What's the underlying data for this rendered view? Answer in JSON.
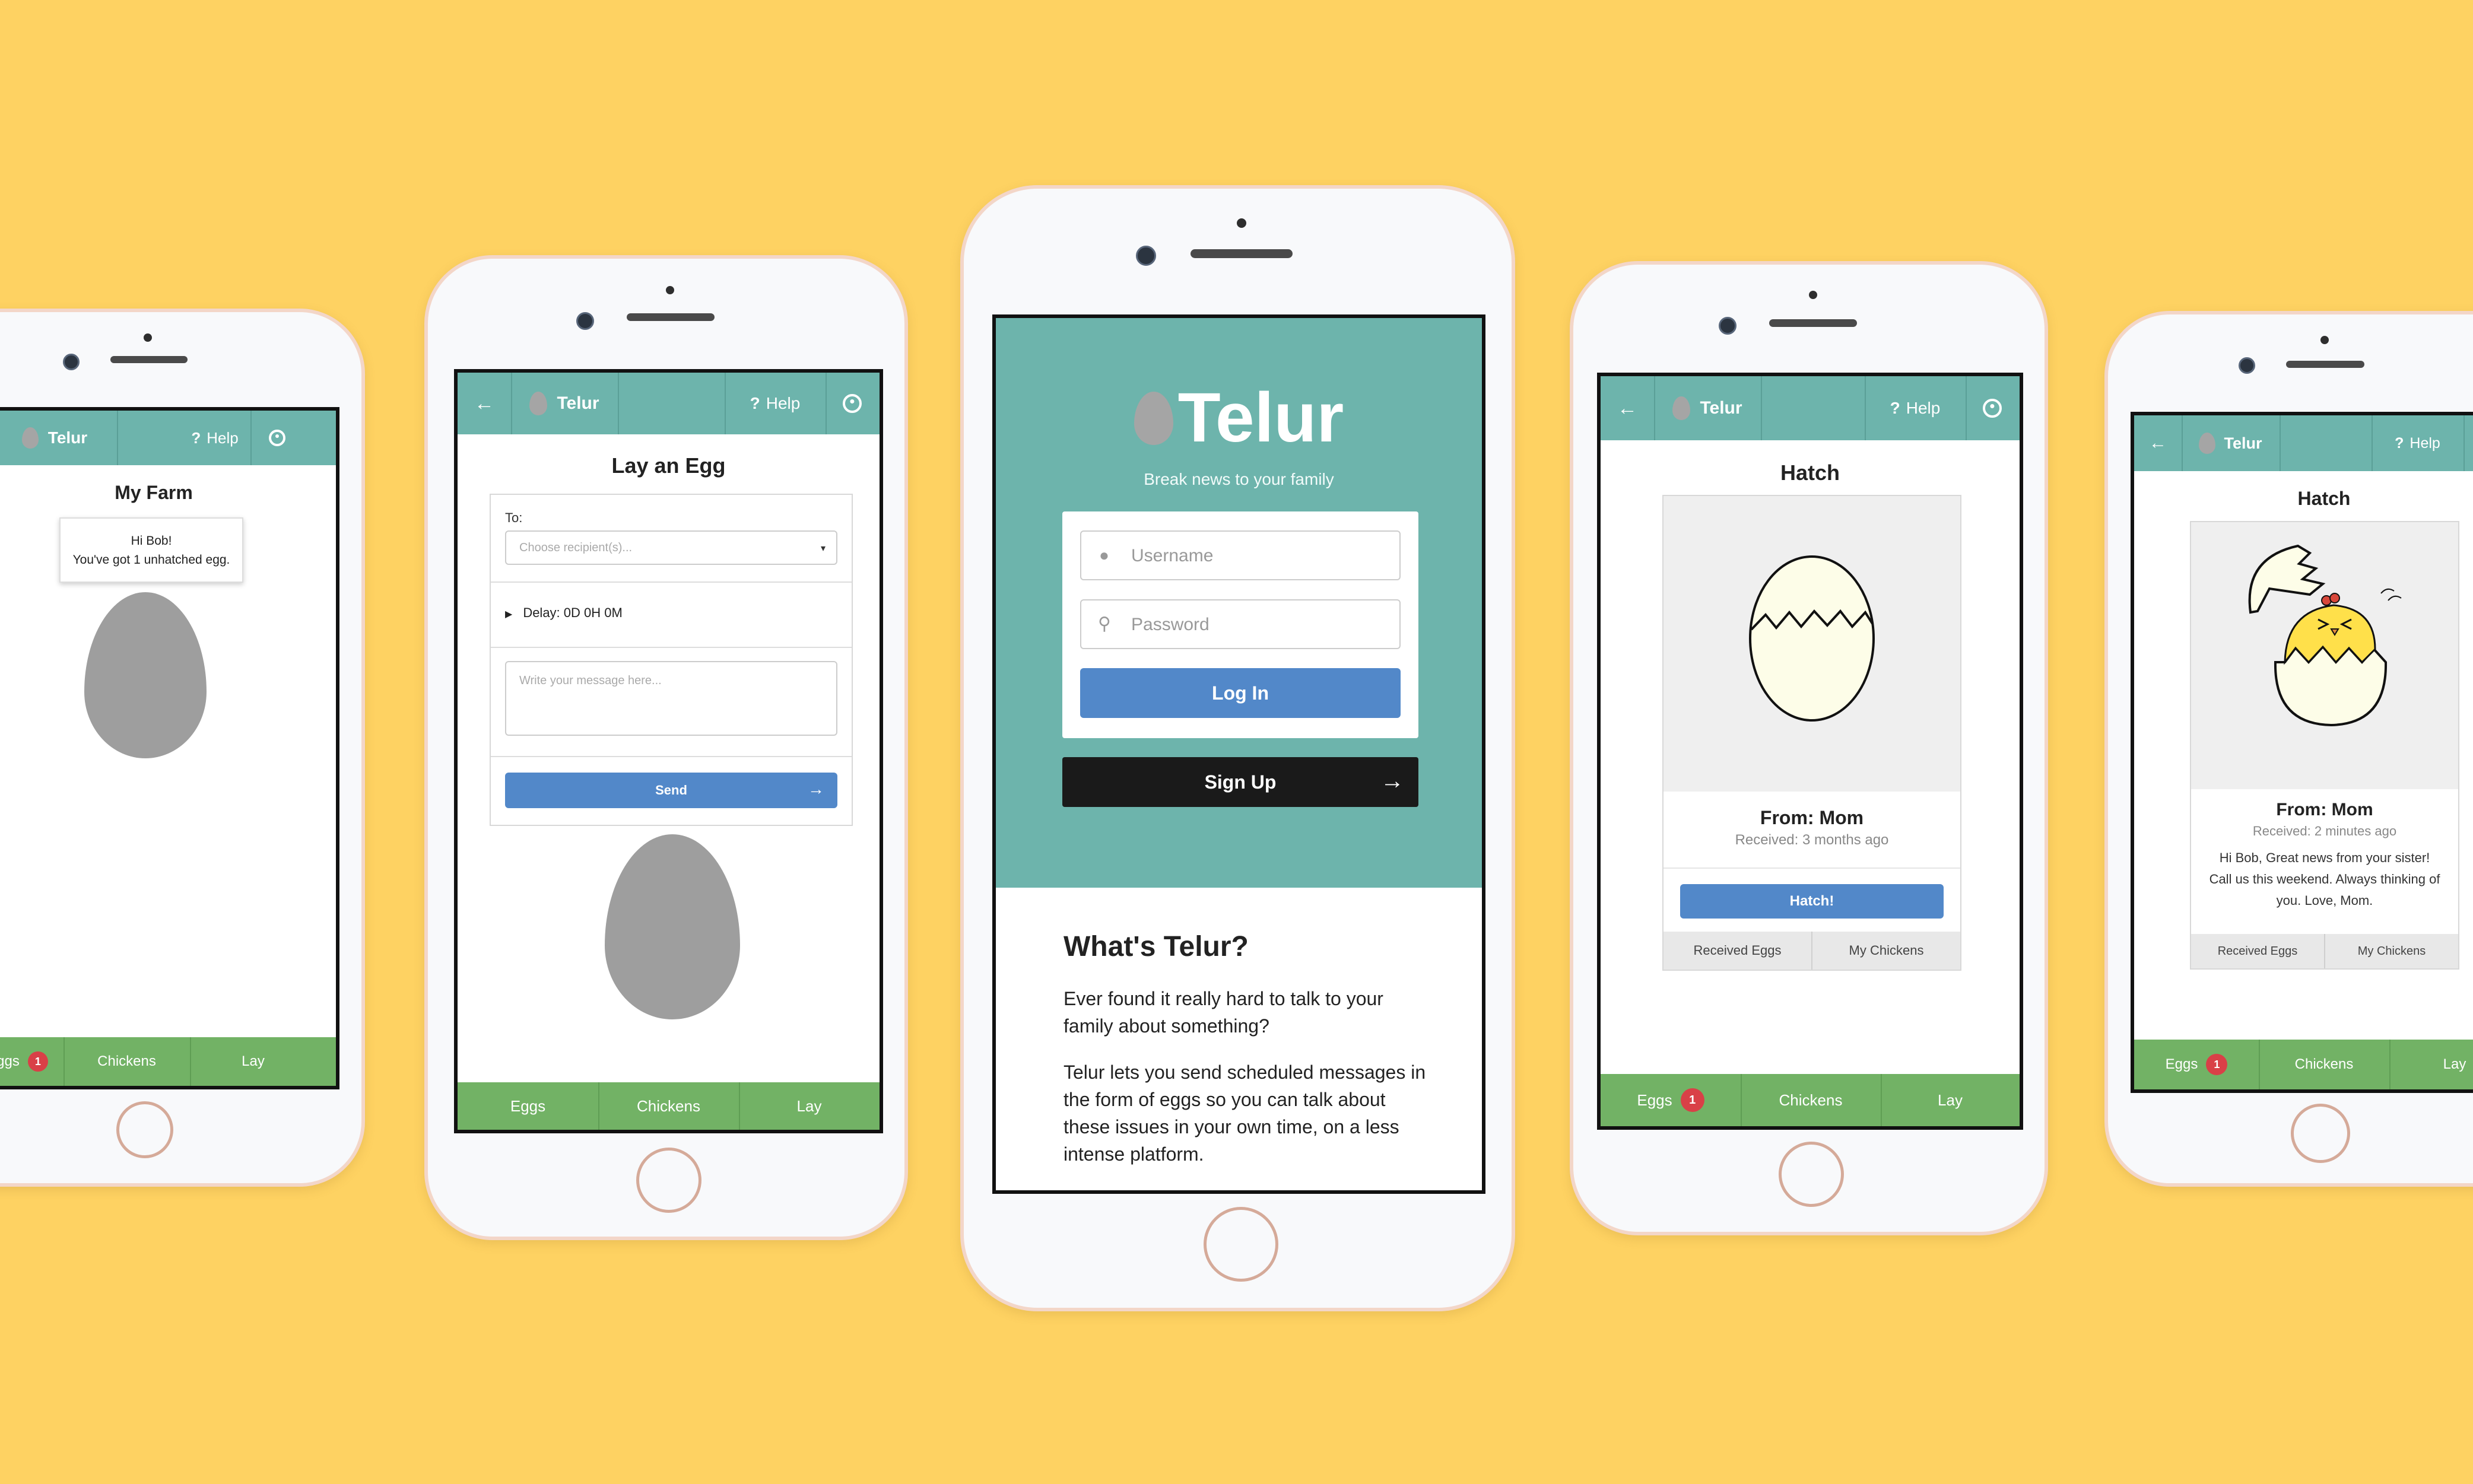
{
  "colors": {
    "background": "#FED262",
    "teal": "#6db4ac",
    "green": "#72b265",
    "blue": "#5288c9",
    "badge": "#d94047",
    "dark": "#1a1a1a"
  },
  "app": {
    "name": "Telur",
    "help_label": "Help",
    "help_icon": "question-icon",
    "back_icon": "arrow-left-icon",
    "user_icon": "user-circle-icon"
  },
  "nav": {
    "eggs": "Eggs",
    "chickens": "Chickens",
    "lay": "Lay",
    "badge_count": "1"
  },
  "phone1": {
    "title": "My Farm",
    "tooltip_line1": "Hi Bob!",
    "tooltip_line2": "You've got 1 unhatched egg."
  },
  "phone2": {
    "title": "Lay an Egg",
    "to_label": "To:",
    "recipient_placeholder": "Choose recipient(s)...",
    "delay_label": "Delay: 0D 0H 0M",
    "message_placeholder": "Write your message here...",
    "send_label": "Send"
  },
  "phone3": {
    "logo": "Telur",
    "tagline": "Break news to your family",
    "username_placeholder": "Username",
    "password_placeholder": "Password",
    "login_label": "Log In",
    "signup_label": "Sign Up",
    "about_title": "What's Telur?",
    "about_p1": "Ever found it really hard to talk to your family about something?",
    "about_p2": "Telur lets you send scheduled messages in the form of eggs so you can talk about these issues in your own time, on a less intense platform."
  },
  "phone4": {
    "title": "Hatch",
    "from": "From: Mom",
    "received": "Received: 3 months ago",
    "hatch_label": "Hatch!",
    "tab_received": "Received Eggs",
    "tab_chickens": "My Chickens"
  },
  "phone5": {
    "title": "Hatch",
    "from": "From: Mom",
    "received": "Received: 2 minutes ago",
    "message": "Hi Bob, Great news from your sister! Call us this weekend. Always thinking of you. Love, Mom.",
    "tab_received": "Received Eggs",
    "tab_chickens": "My Chickens"
  }
}
